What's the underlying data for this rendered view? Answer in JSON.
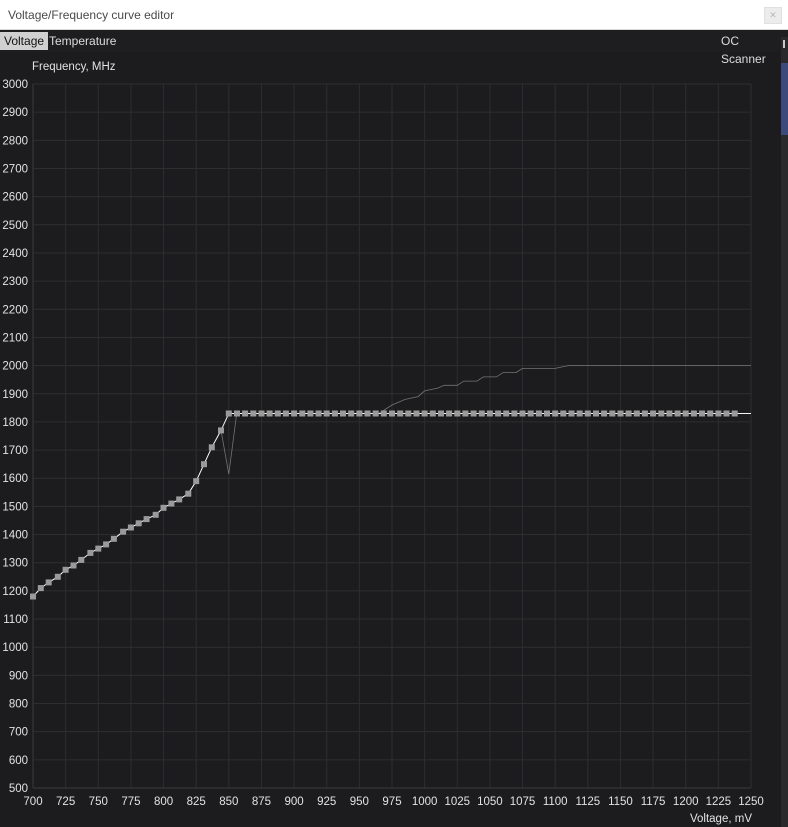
{
  "window": {
    "title": "Voltage/Frequency curve editor",
    "close_icon": "close-icon"
  },
  "tabs": [
    {
      "label": "Voltage",
      "active": true
    },
    {
      "label": "Temperature",
      "active": false
    }
  ],
  "oc_scanner_label": "OC Scanner",
  "colors": {
    "background": "#1c1c1e",
    "grid": "#2e2e31",
    "curve": "#ffffff",
    "marker": "#9a9a9a",
    "reference": "#8a8a8a",
    "scrollbar_thumb": "#3b4a7a"
  },
  "chart_data": {
    "type": "line",
    "xlabel": "Voltage, mV",
    "ylabel": "Frequency, MHz",
    "xlim": [
      700,
      1250
    ],
    "ylim": [
      500,
      3000
    ],
    "xticks": [
      700,
      725,
      750,
      775,
      800,
      825,
      850,
      875,
      900,
      925,
      950,
      975,
      1000,
      1025,
      1050,
      1075,
      1100,
      1125,
      1150,
      1175,
      1200,
      1225,
      1250
    ],
    "yticks": [
      500,
      600,
      700,
      800,
      900,
      1000,
      1100,
      1200,
      1300,
      1400,
      1500,
      1600,
      1700,
      1800,
      1900,
      2000,
      2100,
      2200,
      2300,
      2400,
      2500,
      2600,
      2700,
      2800,
      2900,
      3000
    ],
    "grid": true,
    "series": [
      {
        "role": "reference",
        "points": [
          [
            700,
            1180
          ],
          [
            706,
            1210
          ],
          [
            712,
            1230
          ],
          [
            719,
            1250
          ],
          [
            725,
            1275
          ],
          [
            731,
            1290
          ],
          [
            737,
            1310
          ],
          [
            744,
            1335
          ],
          [
            750,
            1350
          ],
          [
            756,
            1365
          ],
          [
            762,
            1385
          ],
          [
            769,
            1410
          ],
          [
            775,
            1425
          ],
          [
            781,
            1440
          ],
          [
            787,
            1455
          ],
          [
            794,
            1470
          ],
          [
            800,
            1495
          ],
          [
            806,
            1510
          ],
          [
            812,
            1525
          ],
          [
            819,
            1545
          ],
          [
            825,
            1590
          ],
          [
            831,
            1650
          ],
          [
            837,
            1710
          ],
          [
            844,
            1770
          ],
          [
            850,
            1615
          ],
          [
            856,
            1830
          ],
          [
            965,
            1830
          ],
          [
            975,
            1860
          ],
          [
            985,
            1880
          ],
          [
            995,
            1890
          ],
          [
            1000,
            1910
          ],
          [
            1010,
            1920
          ],
          [
            1015,
            1930
          ],
          [
            1025,
            1930
          ],
          [
            1030,
            1945
          ],
          [
            1040,
            1945
          ],
          [
            1045,
            1960
          ],
          [
            1055,
            1960
          ],
          [
            1060,
            1975
          ],
          [
            1070,
            1975
          ],
          [
            1075,
            1990
          ],
          [
            1100,
            1990
          ],
          [
            1110,
            2000
          ],
          [
            1250,
            2000
          ]
        ]
      },
      {
        "role": "curve",
        "points": [
          [
            700,
            1180
          ],
          [
            706,
            1210
          ],
          [
            712,
            1230
          ],
          [
            719,
            1250
          ],
          [
            725,
            1275
          ],
          [
            731,
            1290
          ],
          [
            737,
            1310
          ],
          [
            744,
            1335
          ],
          [
            750,
            1350
          ],
          [
            756,
            1365
          ],
          [
            762,
            1385
          ],
          [
            769,
            1410
          ],
          [
            775,
            1425
          ],
          [
            781,
            1440
          ],
          [
            787,
            1455
          ],
          [
            794,
            1470
          ],
          [
            800,
            1495
          ],
          [
            806,
            1510
          ],
          [
            812,
            1525
          ],
          [
            819,
            1545
          ],
          [
            825,
            1590
          ],
          [
            831,
            1650
          ],
          [
            837,
            1710
          ],
          [
            844,
            1770
          ],
          [
            850,
            1830
          ],
          [
            1250,
            1830
          ]
        ]
      }
    ],
    "markers": {
      "y_flat": 1830,
      "flat_x_start": 850,
      "flat_x_end": 1237.5,
      "flat_x_step": 6.25
    }
  }
}
